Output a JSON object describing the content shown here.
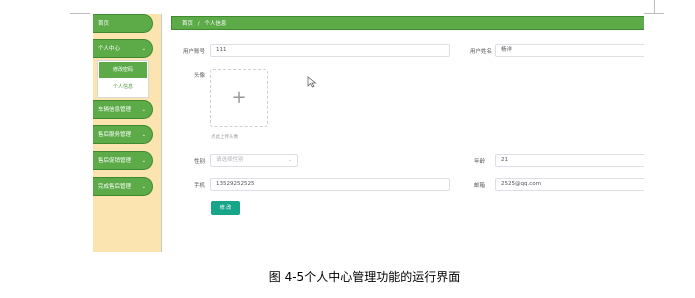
{
  "sidebar": {
    "items": [
      {
        "label": "首页",
        "has_chevron": false
      },
      {
        "label": "个人中心",
        "has_chevron": true
      },
      {
        "label": "车辆信息管理",
        "has_chevron": true
      },
      {
        "label": "售后服务管理",
        "has_chevron": true
      },
      {
        "label": "售后促销管理",
        "has_chevron": true
      },
      {
        "label": "完成售后管理",
        "has_chevron": true
      }
    ],
    "submenu": [
      {
        "label": "修改密码",
        "active": true
      },
      {
        "label": "个人信息",
        "active": false
      }
    ]
  },
  "breadcrumb": {
    "home": "首页",
    "separator": "/",
    "current": "个人信息"
  },
  "form": {
    "account_label": "用户账号",
    "account_value": "111",
    "name_label": "用户姓名",
    "name_value": "杨洋",
    "avatar_label": "头像",
    "upload_hint": "点此上传头像",
    "gender_label": "性别",
    "gender_placeholder": "请选择性别",
    "age_label": "年龄",
    "age_value": "21",
    "phone_label": "手机",
    "phone_value": "13529252525",
    "email_label": "邮箱",
    "email_value": "2525@qq.com",
    "submit_label": "修 改"
  },
  "caption": "图 4-5个人中心管理功能的运行界面",
  "colors": {
    "menu_green": "#5cab48",
    "sidebar_bg": "#fbe4b0",
    "button_teal": "#17a589"
  }
}
